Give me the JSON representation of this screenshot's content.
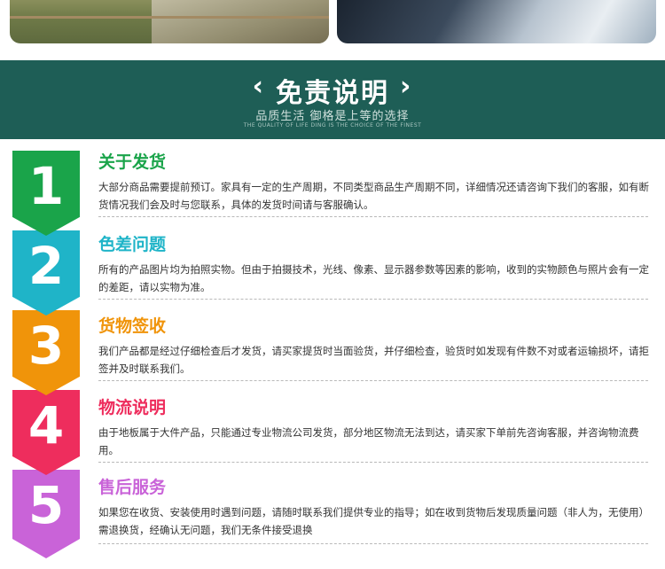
{
  "header": {
    "title": "免责说明",
    "subtitle": "品质生活  御格是上等的选择",
    "subtitle_en": "THE QUALITY OF LIFE DING IS THE CHOICE OF THE FINEST",
    "left_chevron": "‹",
    "right_chevron": "›"
  },
  "sections": [
    {
      "number": "1",
      "title": "关于发货",
      "color": "#1aa44a",
      "body": "大部分商品需要提前预订。家具有一定的生产周期，不同类型商品生产周期不同，详细情况还请咨询下我们的客服，如有断货情况我们会及时与您联系，具体的发货时间请与客服确认。"
    },
    {
      "number": "2",
      "title": "色差问题",
      "color": "#1fb4c8",
      "body": "所有的产品图片均为拍照实物。但由于拍摄技术，光线、像素、显示器参数等因素的影响，收到的实物颜色与照片会有一定的差距，请以实物为准。"
    },
    {
      "number": "3",
      "title": "货物签收",
      "color": "#f0940a",
      "body": "我们产品都是经过仔细检查后才发货，请买家提货时当面验货，并仔细检查，验货时如发现有件数不对或者运输损坏，请拒签并及时联系我们。"
    },
    {
      "number": "4",
      "title": "物流说明",
      "color": "#ee2d5d",
      "body": "由于地板属于大件产品，只能通过专业物流公司发货，部分地区物流无法到达，请买家下单前先咨询客服，并咨询物流费用。"
    },
    {
      "number": "5",
      "title": "售后服务",
      "color": "#c963d8",
      "body": "如果您在收货、安装使用时遇到问题，请随时联系我们提供专业的指导；如在收到货物后发现质量问题（非人为，无使用）需退换货，经确认无问题，我们无条件接受退换"
    }
  ]
}
